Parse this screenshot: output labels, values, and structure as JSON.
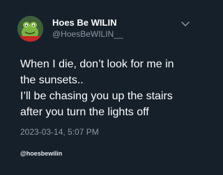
{
  "author": {
    "display_name": "Hoes Be WILIN",
    "handle": "@HoesBeWILIN__",
    "avatar_icon": "kermit-frog-avatar"
  },
  "tweet": {
    "lines": [
      "When I die, don’t look for me in",
      "the sunsets..",
      "I’ll be chasing you up the stairs",
      "after you turn the lights off"
    ],
    "timestamp": "2023-03-14, 5:07 PM"
  },
  "menu_icon": "chevron-down-icon",
  "watermark": "@hoesbewilin",
  "colors": {
    "background": "#15202b",
    "text": "#ffffff",
    "secondary_text": "#8b98a5"
  }
}
